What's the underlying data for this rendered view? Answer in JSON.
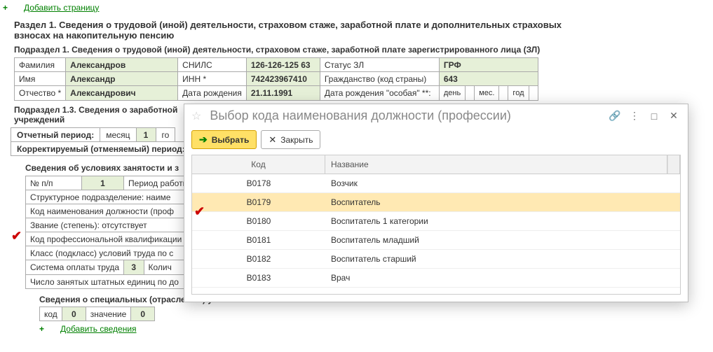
{
  "links": {
    "add_page": "Добавить страницу",
    "add_info": "Добавить сведения"
  },
  "section1_title": "Раздел 1. Сведения о трудовой (иной) деятельности, страховом стаже, заработной плате и дополнительных страховых взносах на накопительную пенсию",
  "subsection1_title": "Подраздел 1. Сведения о трудовой (иной) деятельности, страховом стаже, заработной плате зарегистрированного лица (ЗЛ)",
  "person": {
    "lastname_label": "Фамилия",
    "lastname": "Александров",
    "snils_label": "СНИЛС",
    "snils": "126-126-125 63",
    "status_label": "Статус ЗЛ",
    "grf_label": "ГРФ",
    "firstname_label": "Имя",
    "firstname": "Александр",
    "inn_label": "ИНН *",
    "inn": "742423967410",
    "citizenship_label": "Гражданство (код страны)",
    "citizenship": "643",
    "patronymic_label": "Отчество *",
    "patronymic": "Александрович",
    "dob_label": "Дата рождения",
    "dob": "21.11.1991",
    "dob_special_label": "Дата рождения \"особая\" **:",
    "day_label": "день",
    "month_label": "мес.",
    "year_label": "год"
  },
  "subsection13_title": "Подраздел 1.3.  Сведения о заработной\nучреждений",
  "period": {
    "report_label": "Отчетный период:",
    "month_label": "месяц",
    "month_val": "1",
    "year_label": "го",
    "corr_label": "Корректируемый (отменяемый) период:"
  },
  "employment": {
    "title": "Сведения об условиях занятости и з",
    "np_label": "№ п/п",
    "np_val": "1",
    "work_period_label": "Период работы в о",
    "struct_unit_label": "Структурное подразделение:   наиме",
    "job_code_label": "Код наименования должности (проф",
    "rank_label": "Звание (степень):   отсутствует",
    "prof_qual_label": "Код профессиональной квалификации",
    "class_conditions_label": "Класс (подкласс) условий труда по с",
    "pay_system_label": "Система оплаты труда",
    "pay_system_val": "3",
    "quantity_label": "Колич",
    "positions_count_label": "Число занятых штатных единиц по до"
  },
  "special": {
    "title": "Сведения о специальных (отраслевых) условиях занятости",
    "code_label": "код",
    "code_val": "0",
    "value_label": "значение",
    "value_val": "0"
  },
  "popup": {
    "title": "Выбор кода наименования должности (профессии)",
    "btn_select": "Выбрать",
    "btn_close": "Закрыть",
    "col_code": "Код",
    "col_name": "Название",
    "rows": [
      {
        "code": "B0178",
        "name": "Возчик"
      },
      {
        "code": "B0179",
        "name": "Воспитатель"
      },
      {
        "code": "B0180",
        "name": "Воспитатель 1 категории"
      },
      {
        "code": "B0181",
        "name": "Воспитатель младший"
      },
      {
        "code": "B0182",
        "name": "Воспитатель старший"
      },
      {
        "code": "B0183",
        "name": "Врач"
      }
    ],
    "selected_index": 1
  }
}
